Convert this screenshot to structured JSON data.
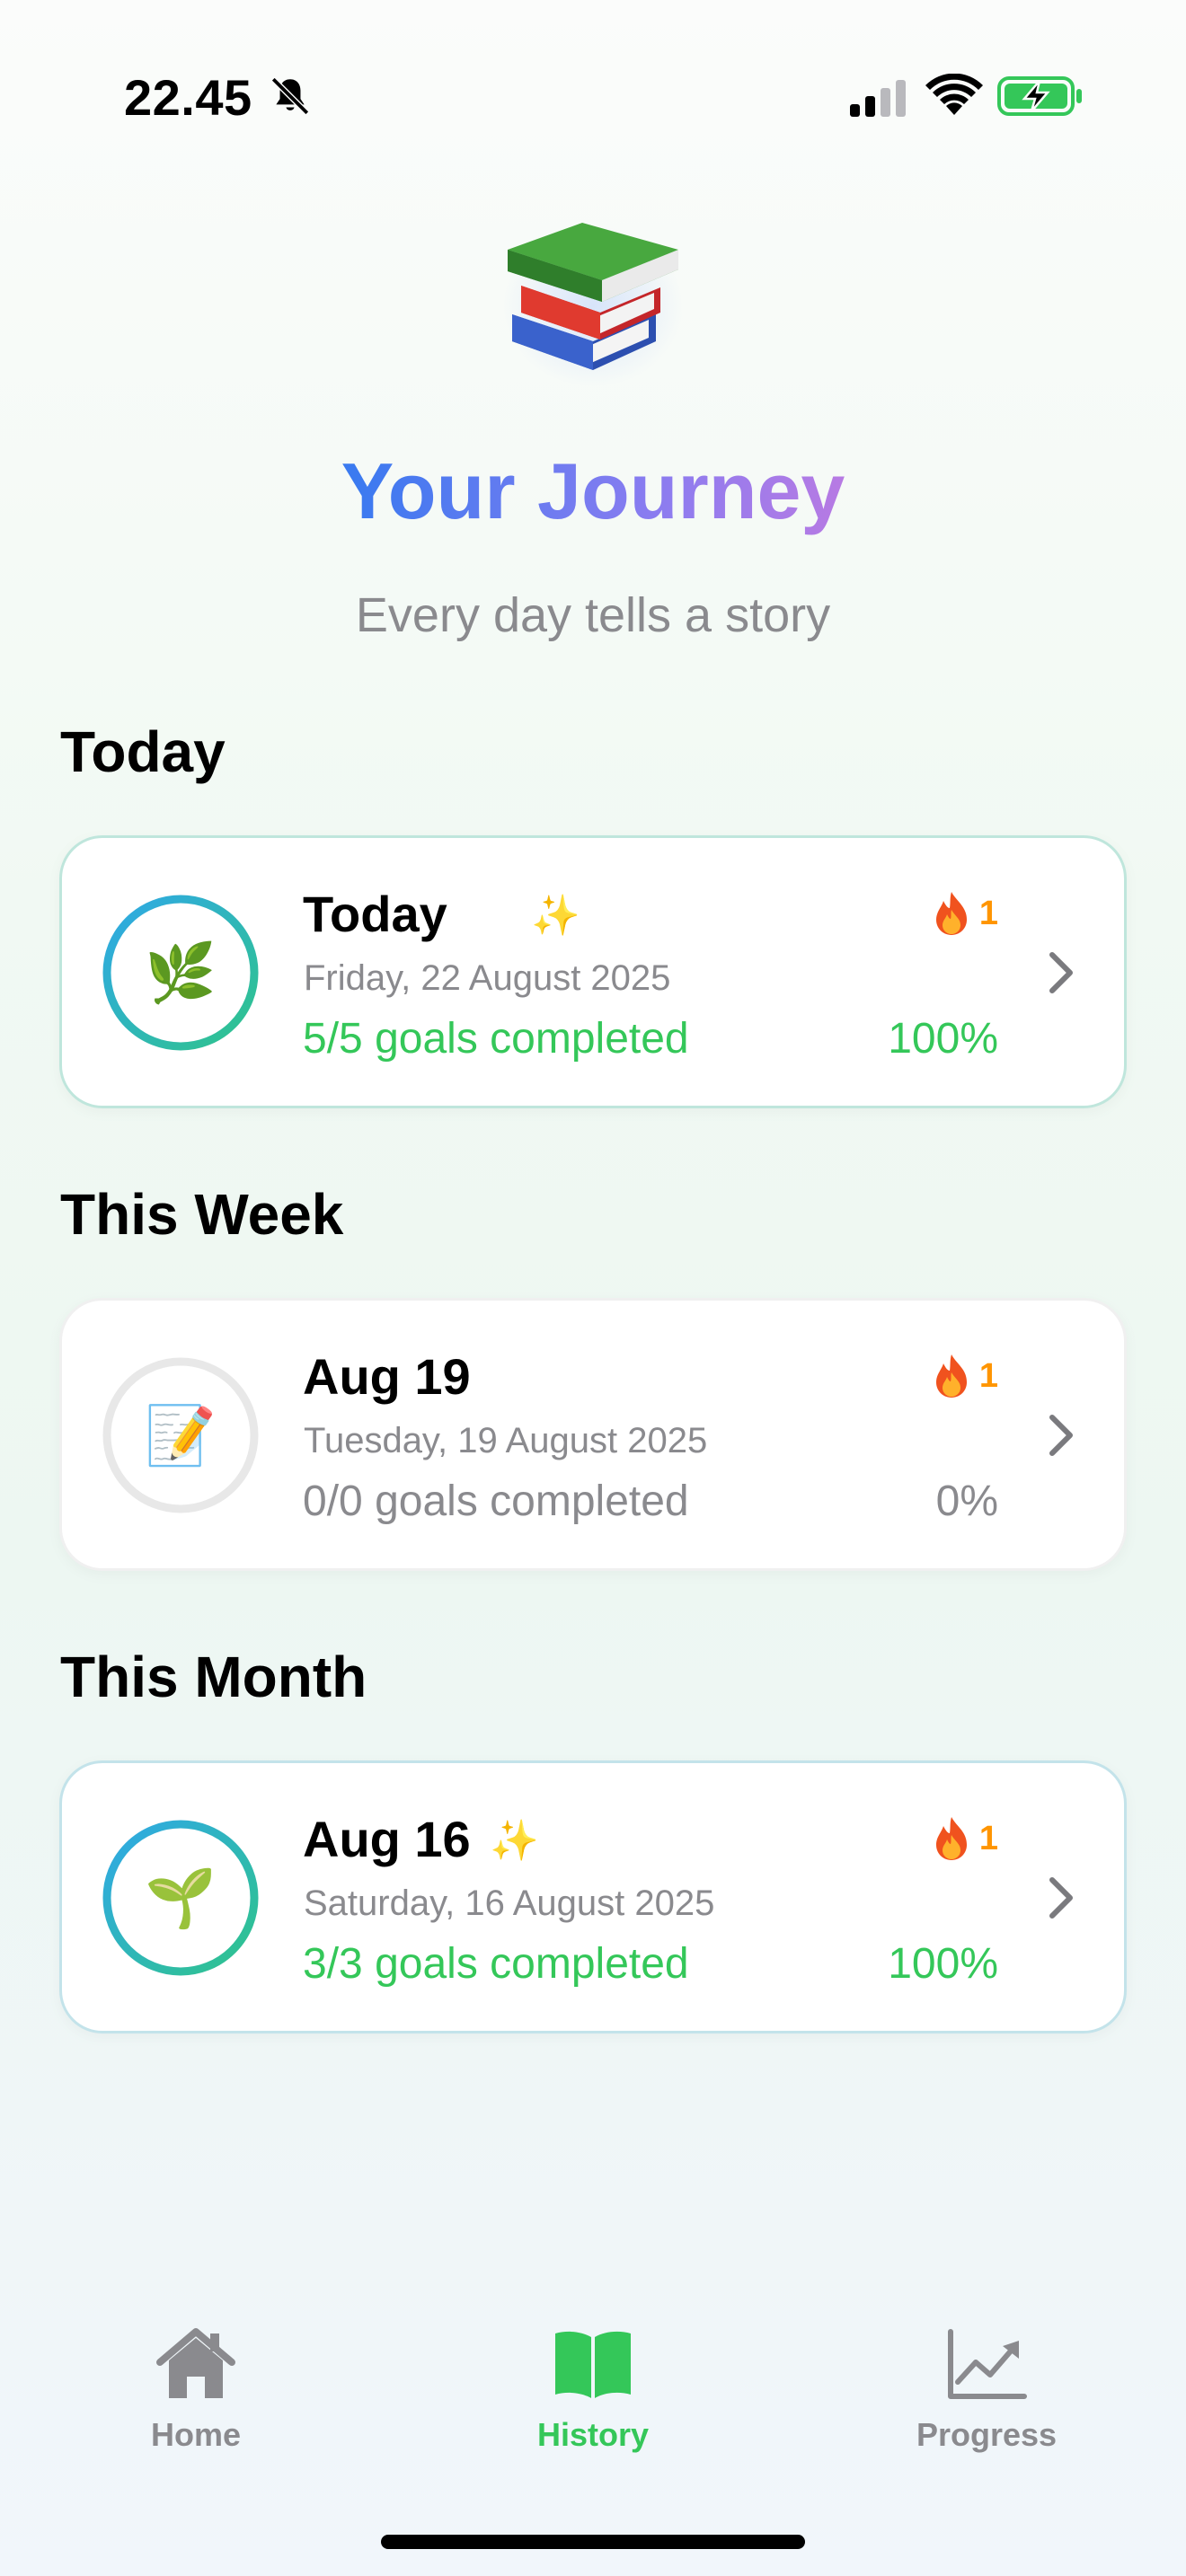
{
  "status_bar": {
    "time": "22.45",
    "icons": [
      "bell-slash-icon",
      "cellular-signal-icon",
      "wifi-icon",
      "battery-charging-icon"
    ]
  },
  "header": {
    "icon": "books-icon",
    "title": "Your Journey",
    "subtitle": "Every day tells a story"
  },
  "sections": [
    {
      "title": "Today",
      "entries": [
        {
          "title": "Today",
          "sparkle": "✨",
          "date": "Friday, 22 August 2025",
          "goals": "5/5 goals completed",
          "percent": "100%",
          "progress": 1.0,
          "streak": "1",
          "emoji": "🌿"
        }
      ]
    },
    {
      "title": "This Week",
      "entries": [
        {
          "title": "Aug 19",
          "date": "Tuesday, 19 August 2025",
          "goals": "0/0 goals completed",
          "percent": "0%",
          "progress": 0.0,
          "streak": "1",
          "emoji": "📝"
        }
      ]
    },
    {
      "title": "This Month",
      "entries": [
        {
          "title": "Aug 16",
          "sparkle": "✨",
          "date": "Saturday, 16 August 2025",
          "goals": "3/3 goals completed",
          "percent": "100%",
          "progress": 1.0,
          "streak": "1",
          "emoji": "🌱"
        }
      ]
    }
  ],
  "tab_bar": {
    "tabs": [
      {
        "label": "Home",
        "icon": "house-icon",
        "active": false
      },
      {
        "label": "History",
        "icon": "open-book-icon",
        "active": true
      },
      {
        "label": "Progress",
        "icon": "chart-line-icon",
        "active": false
      }
    ]
  },
  "colors": {
    "accent_green": "#34c759",
    "streak_orange": "#ff9500",
    "ring_gradient_start": "#2fb3e0",
    "ring_gradient_end": "#2fc48a",
    "title_gradient": [
      "#3b7af0",
      "#8a7cf0",
      "#c27ae0"
    ]
  }
}
